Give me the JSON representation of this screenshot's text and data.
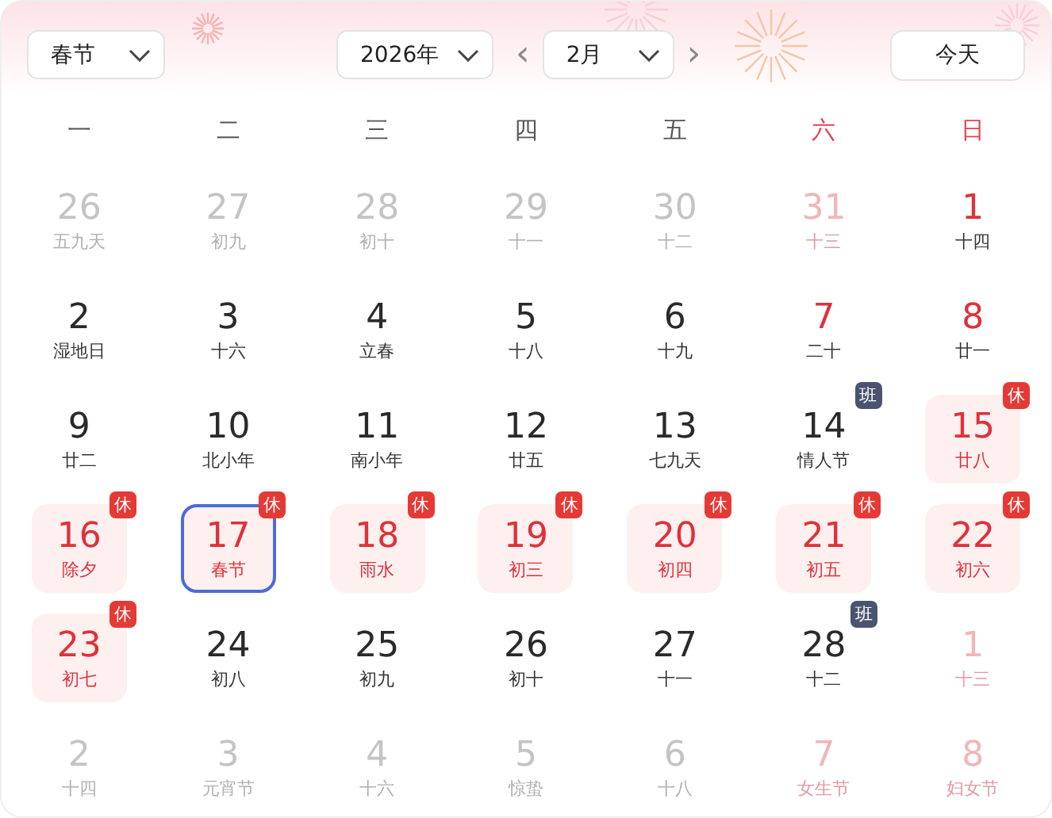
{
  "toolbar": {
    "festival": "春节",
    "year": "2026年",
    "prev": "‹",
    "month": "2月",
    "next": "›",
    "today": "今天"
  },
  "weekdays": [
    {
      "label": "一",
      "weekend": false
    },
    {
      "label": "二",
      "weekend": false
    },
    {
      "label": "三",
      "weekend": false
    },
    {
      "label": "四",
      "weekend": false
    },
    {
      "label": "五",
      "weekend": false
    },
    {
      "label": "六",
      "weekend": true
    },
    {
      "label": "日",
      "weekend": true
    }
  ],
  "days": [
    {
      "day": "26",
      "lunar": "五九天",
      "muted": true,
      "weekend": false,
      "off": false,
      "selected": false
    },
    {
      "day": "27",
      "lunar": "初九",
      "muted": true,
      "weekend": false,
      "off": false,
      "selected": false
    },
    {
      "day": "28",
      "lunar": "初十",
      "muted": true,
      "weekend": false,
      "off": false,
      "selected": false
    },
    {
      "day": "29",
      "lunar": "十一",
      "muted": true,
      "weekend": false,
      "off": false,
      "selected": false
    },
    {
      "day": "30",
      "lunar": "十二",
      "muted": true,
      "weekend": false,
      "off": false,
      "selected": false
    },
    {
      "day": "31",
      "lunar": "十三",
      "muted": true,
      "weekend": true,
      "off": false,
      "selected": false
    },
    {
      "day": "1",
      "lunar": "十四",
      "muted": false,
      "weekend": true,
      "off": false,
      "selected": false
    },
    {
      "day": "2",
      "lunar": "湿地日",
      "muted": false,
      "weekend": false,
      "off": false,
      "selected": false
    },
    {
      "day": "3",
      "lunar": "十六",
      "muted": false,
      "weekend": false,
      "off": false,
      "selected": false
    },
    {
      "day": "4",
      "lunar": "立春",
      "muted": false,
      "weekend": false,
      "off": false,
      "selected": false
    },
    {
      "day": "5",
      "lunar": "十八",
      "muted": false,
      "weekend": false,
      "off": false,
      "selected": false
    },
    {
      "day": "6",
      "lunar": "十九",
      "muted": false,
      "weekend": false,
      "off": false,
      "selected": false
    },
    {
      "day": "7",
      "lunar": "二十",
      "muted": false,
      "weekend": true,
      "off": false,
      "selected": false
    },
    {
      "day": "8",
      "lunar": "廿一",
      "muted": false,
      "weekend": true,
      "off": false,
      "selected": false
    },
    {
      "day": "9",
      "lunar": "廿二",
      "muted": false,
      "weekend": false,
      "off": false,
      "selected": false
    },
    {
      "day": "10",
      "lunar": "北小年",
      "muted": false,
      "weekend": false,
      "off": false,
      "selected": false
    },
    {
      "day": "11",
      "lunar": "南小年",
      "muted": false,
      "weekend": false,
      "off": false,
      "selected": false
    },
    {
      "day": "12",
      "lunar": "廿五",
      "muted": false,
      "weekend": false,
      "off": false,
      "selected": false
    },
    {
      "day": "13",
      "lunar": "七九天",
      "muted": false,
      "weekend": false,
      "off": false,
      "selected": false
    },
    {
      "day": "14",
      "lunar": "情人节",
      "muted": false,
      "weekend": false,
      "off": false,
      "selected": false,
      "badge": {
        "text": "班",
        "kind": "work"
      }
    },
    {
      "day": "15",
      "lunar": "廿八",
      "muted": false,
      "weekend": true,
      "off": true,
      "selected": false,
      "badge": {
        "text": "休",
        "kind": "rest"
      }
    },
    {
      "day": "16",
      "lunar": "除夕",
      "muted": false,
      "weekend": false,
      "off": true,
      "selected": false,
      "badge": {
        "text": "休",
        "kind": "rest"
      }
    },
    {
      "day": "17",
      "lunar": "春节",
      "muted": false,
      "weekend": false,
      "off": true,
      "selected": true,
      "badge": {
        "text": "休",
        "kind": "rest"
      }
    },
    {
      "day": "18",
      "lunar": "雨水",
      "muted": false,
      "weekend": false,
      "off": true,
      "selected": false,
      "badge": {
        "text": "休",
        "kind": "rest"
      }
    },
    {
      "day": "19",
      "lunar": "初三",
      "muted": false,
      "weekend": false,
      "off": true,
      "selected": false,
      "badge": {
        "text": "休",
        "kind": "rest"
      }
    },
    {
      "day": "20",
      "lunar": "初四",
      "muted": false,
      "weekend": false,
      "off": true,
      "selected": false,
      "badge": {
        "text": "休",
        "kind": "rest"
      }
    },
    {
      "day": "21",
      "lunar": "初五",
      "muted": false,
      "weekend": true,
      "off": true,
      "selected": false,
      "badge": {
        "text": "休",
        "kind": "rest"
      }
    },
    {
      "day": "22",
      "lunar": "初六",
      "muted": false,
      "weekend": true,
      "off": true,
      "selected": false,
      "badge": {
        "text": "休",
        "kind": "rest"
      }
    },
    {
      "day": "23",
      "lunar": "初七",
      "muted": false,
      "weekend": false,
      "off": true,
      "selected": false,
      "badge": {
        "text": "休",
        "kind": "rest"
      }
    },
    {
      "day": "24",
      "lunar": "初八",
      "muted": false,
      "weekend": false,
      "off": false,
      "selected": false
    },
    {
      "day": "25",
      "lunar": "初九",
      "muted": false,
      "weekend": false,
      "off": false,
      "selected": false
    },
    {
      "day": "26",
      "lunar": "初十",
      "muted": false,
      "weekend": false,
      "off": false,
      "selected": false
    },
    {
      "day": "27",
      "lunar": "十一",
      "muted": false,
      "weekend": false,
      "off": false,
      "selected": false
    },
    {
      "day": "28",
      "lunar": "十二",
      "muted": false,
      "weekend": false,
      "off": false,
      "selected": false,
      "badge": {
        "text": "班",
        "kind": "work"
      }
    },
    {
      "day": "1",
      "lunar": "十三",
      "muted": true,
      "weekend": true,
      "off": false,
      "selected": false
    },
    {
      "day": "2",
      "lunar": "十四",
      "muted": true,
      "weekend": false,
      "off": false,
      "selected": false
    },
    {
      "day": "3",
      "lunar": "元宵节",
      "muted": true,
      "weekend": false,
      "off": false,
      "selected": false
    },
    {
      "day": "4",
      "lunar": "十六",
      "muted": true,
      "weekend": false,
      "off": false,
      "selected": false
    },
    {
      "day": "5",
      "lunar": "惊蛰",
      "muted": true,
      "weekend": false,
      "off": false,
      "selected": false
    },
    {
      "day": "6",
      "lunar": "十八",
      "muted": true,
      "weekend": false,
      "off": false,
      "selected": false
    },
    {
      "day": "7",
      "lunar": "女生节",
      "muted": true,
      "weekend": true,
      "off": false,
      "selected": false
    },
    {
      "day": "8",
      "lunar": "妇女节",
      "muted": true,
      "weekend": true,
      "off": false,
      "selected": false
    }
  ]
}
